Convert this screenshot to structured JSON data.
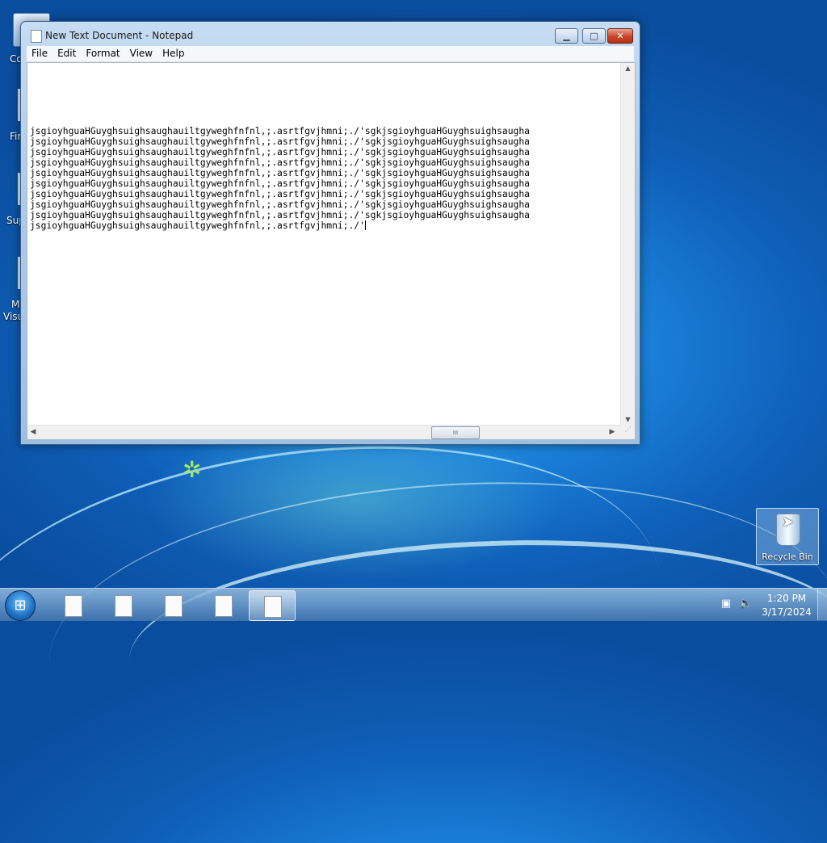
{
  "desktop": {
    "left_icons": [
      {
        "label": "Co"
      },
      {
        "label": "Fir"
      },
      {
        "label": "Sup"
      },
      {
        "label": "M",
        "label2": "Visu"
      }
    ],
    "recycle_bin_label": "Recycle Bin"
  },
  "window": {
    "title": "New Text Document - Notepad",
    "buttons": {
      "minimize": "▁",
      "maximize": "□",
      "close": "✕"
    },
    "menu": [
      "File",
      "Edit",
      "Format",
      "View",
      "Help"
    ],
    "text_lines": [
      "jsgioyhguaHGuyghsuighsaughauiltgyweghfnfnl,;.asrtfgvjhmni;./'sgkjsgioyhguaHGuyghsuighsaugha",
      "jsgioyhguaHGuyghsuighsaughauiltgyweghfnfnl,;.asrtfgvjhmni;./'sgkjsgioyhguaHGuyghsuighsaugha",
      "jsgioyhguaHGuyghsuighsaughauiltgyweghfnfnl,;.asrtfgvjhmni;./'sgkjsgioyhguaHGuyghsuighsaugha",
      "jsgioyhguaHGuyghsuighsaughauiltgyweghfnfnl,;.asrtfgvjhmni;./'sgkjsgioyhguaHGuyghsuighsaugha",
      "jsgioyhguaHGuyghsuighsaughauiltgyweghfnfnl,;.asrtfgvjhmni;./'sgkjsgioyhguaHGuyghsuighsaugha",
      "jsgioyhguaHGuyghsuighsaughauiltgyweghfnfnl,;.asrtfgvjhmni;./'sgkjsgioyhguaHGuyghsuighsaugha",
      "jsgioyhguaHGuyghsuighsaughauiltgyweghfnfnl,;.asrtfgvjhmni;./'sgkjsgioyhguaHGuyghsuighsaugha",
      "jsgioyhguaHGuyghsuighsaughauiltgyweghfnfnl,;.asrtfgvjhmni;./'sgkjsgioyhguaHGuyghsuighsaugha",
      "jsgioyhguaHGuyghsuighsaughauiltgyweghfnfnl,;.asrtfgvjhmni;./'sgkjsgioyhguaHGuyghsuighsaugha",
      "jsgioyhguaHGuyghsuighsaughauiltgyweghfnfnl,;.asrtfgvjhmni;./'"
    ],
    "scroll_thumb_grip": "III"
  },
  "taskbar": {
    "start_icon": "windows-orb",
    "items": [
      {
        "icon": "document-icon",
        "active": false
      },
      {
        "icon": "document-icon",
        "active": false
      },
      {
        "icon": "document-icon",
        "active": false
      },
      {
        "icon": "document-icon",
        "active": false
      },
      {
        "icon": "document-icon",
        "active": true
      }
    ],
    "tray": {
      "network_icon": "network-icon",
      "volume_icon": "volume-muted-icon"
    },
    "time": "1:20 PM",
    "date": "3/17/2024"
  },
  "colors": {
    "accent": "#1a7fd8",
    "close_button": "#c8442a"
  }
}
